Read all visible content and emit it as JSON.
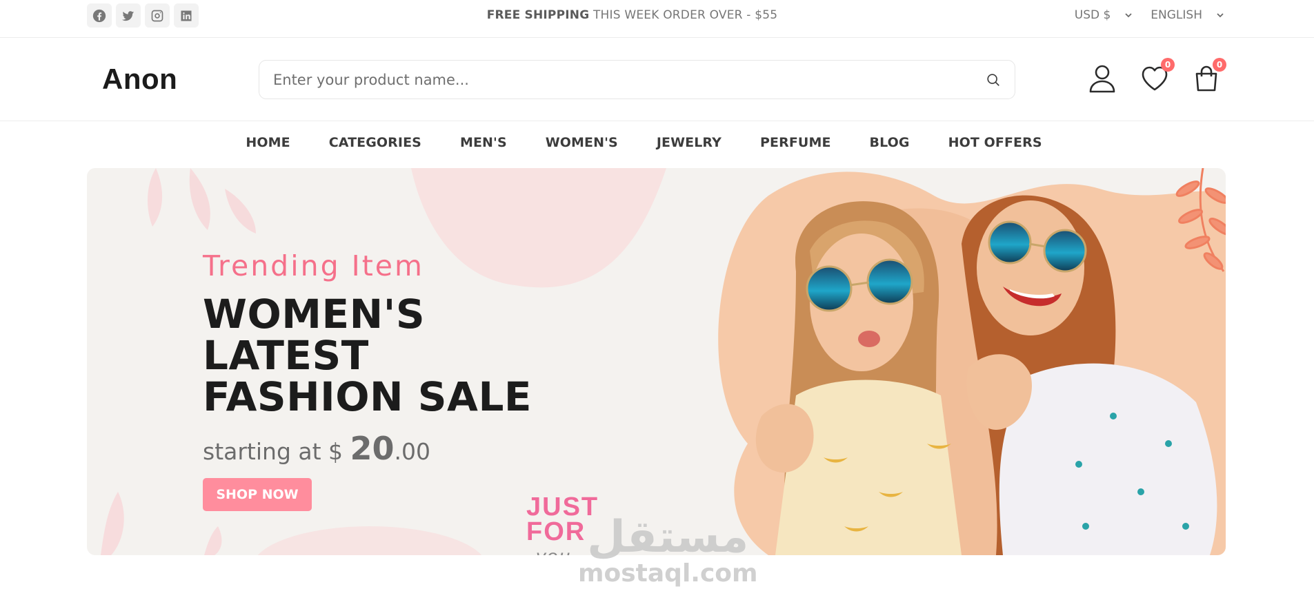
{
  "topbar": {
    "social": [
      {
        "icon": "facebook-icon"
      },
      {
        "icon": "twitter-icon"
      },
      {
        "icon": "instagram-icon"
      },
      {
        "icon": "linkedin-icon"
      }
    ],
    "shipping_bold": "FREE SHIPPING",
    "shipping_rest": "THIS WEEK ORDER OVER - $55",
    "currency": "USD $",
    "language": "ENGLISH"
  },
  "header": {
    "logo": "Anon",
    "search_placeholder": "Enter your product name...",
    "wishlist_count": "0",
    "cart_count": "0"
  },
  "nav": {
    "items": [
      "HOME",
      "CATEGORIES",
      "MEN'S",
      "WOMEN'S",
      "JEWELRY",
      "PERFUME",
      "BLOG",
      "HOT OFFERS"
    ]
  },
  "hero": {
    "subtitle": "Trending Item",
    "title_line1": "WOMEN'S LATEST",
    "title_line2": "FASHION SALE",
    "price_prefix": "starting at $",
    "price_whole": "20",
    "price_cents": ".00",
    "button": "SHOP NOW",
    "tagline_1": "JUST",
    "tagline_2": "FOR",
    "tagline_3": "you"
  },
  "watermark": {
    "arabic": "مستقل",
    "site": "mostaql.com"
  },
  "colors": {
    "accent": "#ff8d9d",
    "trending": "#f5708a",
    "badge": "#ff6b6b",
    "hero_bg": "#f4f2ef",
    "peach": "#f6c9a8"
  }
}
